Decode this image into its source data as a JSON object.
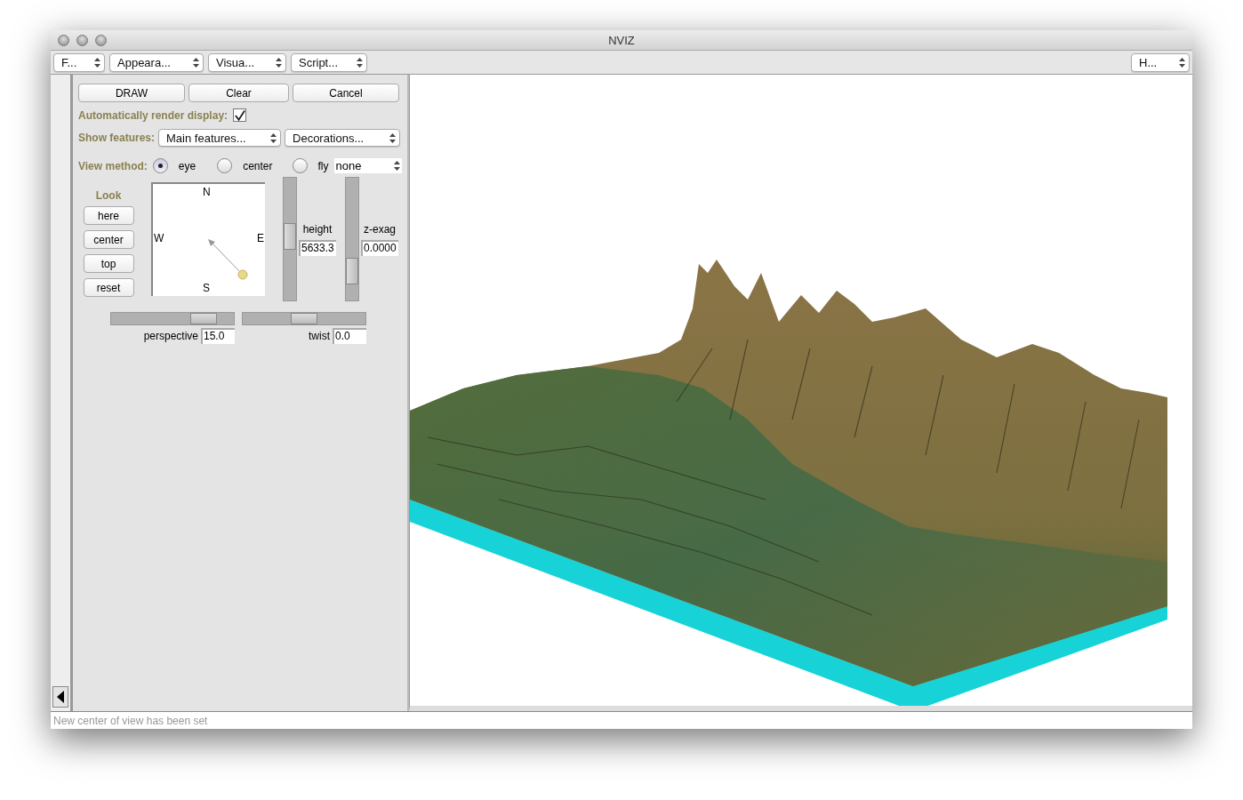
{
  "window": {
    "title": "NVIZ"
  },
  "menus": [
    {
      "label": "F..."
    },
    {
      "label": "Appeara..."
    },
    {
      "label": "Visua..."
    },
    {
      "label": "Script..."
    }
  ],
  "help_menu": {
    "label": "H..."
  },
  "buttons": [
    "DRAW",
    "Clear",
    "Cancel"
  ],
  "auto_render": {
    "label": "Automatically render display:",
    "checked": true
  },
  "show_features": {
    "label": "Show features:",
    "dropdowns": [
      "Main features...",
      "Decorations..."
    ]
  },
  "view_method": {
    "label": "View method:",
    "options": [
      {
        "label": "eye",
        "selected": true
      },
      {
        "label": "center",
        "selected": false
      },
      {
        "label": "fly",
        "selected": false
      }
    ],
    "fly_mode": "none"
  },
  "look": {
    "label": "Look",
    "buttons": [
      "here",
      "center",
      "top",
      "reset"
    ]
  },
  "compass": {
    "north": "N",
    "west": "W",
    "east": "E",
    "south": "S"
  },
  "height": {
    "label": "height",
    "value": "5633.3",
    "level": 0.53
  },
  "z_exag": {
    "label": "z-exag",
    "value": "0.0000",
    "level": 0.17
  },
  "perspective": {
    "label": "perspective",
    "value": "15.0",
    "level": 0.82
  },
  "twist": {
    "label": "twist",
    "value": "0.0",
    "level": 0.5
  },
  "status_bar": {
    "text": "New center of view has been set"
  }
}
